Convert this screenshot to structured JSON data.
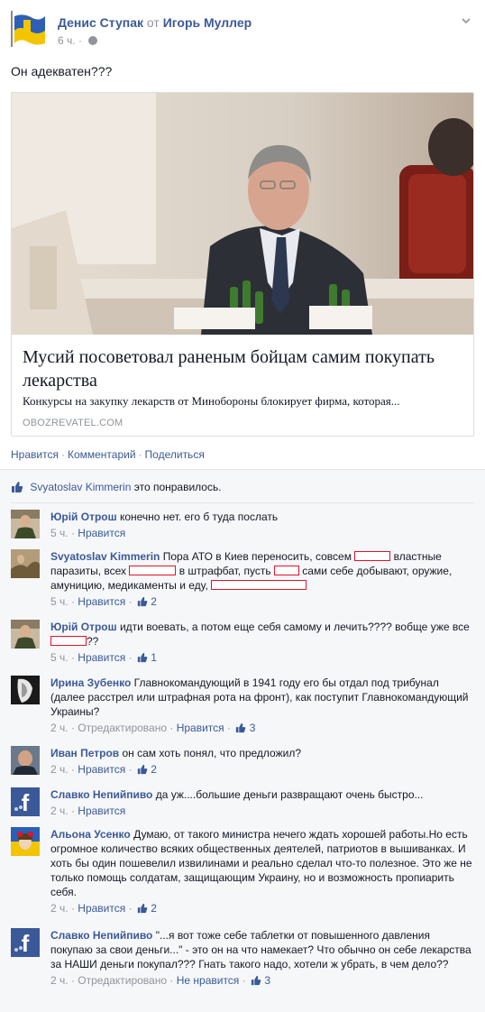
{
  "post": {
    "author": "Денис Ступак",
    "to_word": "от",
    "target": "Игорь Муллер",
    "time": "6 ч.",
    "text": "Он адекватен???",
    "link": {
      "title": "Мусий посоветовал раненым бойцам самим покупать лекарства",
      "description": "Конкурсы на закупку лекарств от Минобороны блокирует фирма, которая...",
      "domain": "OBOZREVATEL.COM"
    },
    "actions": {
      "like": "Нравится",
      "comment": "Комментарий",
      "share": "Поделиться",
      "separator": "·"
    }
  },
  "likes": {
    "user": "Svyatoslav Kimmerin",
    "suffix": "это понравилось."
  },
  "comments": [
    {
      "author": "Юрій Отрош",
      "text": "конечно нет. его б туда послать",
      "time": "5 ч.",
      "like": "Нравится",
      "count": ""
    },
    {
      "author": "Svyatoslav Kimmerin",
      "parts": [
        "Пора АТО в Киев переносить, совсем",
        "властные паразиты, всех",
        "в штрафбат, пусть",
        "сами себе добывают, оружие, амуницию, медикаменты и еду,"
      ],
      "time": "5 ч.",
      "like": "Нравится",
      "count": "2"
    },
    {
      "author": "Юрій Отрош",
      "parts": [
        "идти воевать, а потом еще себя самому и лечить???? вобще уже все",
        "??"
      ],
      "time": "5 ч.",
      "like": "Нравится",
      "count": "1"
    },
    {
      "author": "Ирина Зубенко",
      "text": "Главнокомандующий в 1941 году его бы отдал под трибунал (далее расстрел или штрафная рота на фронт), как поступит Главнокомандующий Украины?",
      "time": "2 ч.",
      "edited": "Отредактировано",
      "like": "Нравится",
      "count": "3"
    },
    {
      "author": "Иван Петров",
      "text": "он сам хоть понял, что предложил?",
      "time": "2 ч.",
      "like": "Нравится",
      "count": "2"
    },
    {
      "author": "Славко Непийпиво",
      "text": "да уж....большие деньги развращают очень быстро...",
      "time": "2 ч.",
      "like": "Нравится",
      "count": ""
    },
    {
      "author": "Альона Усенко",
      "text": "Думаю, от такого министра нечего ждать хорошей работы.Но есть огромное количество всяких общественных деятелей, патриотов в вышиванках. И хоть бы один пошевелил извилинами и реально сделал что-то полезное. Это же не только помощь солдатам, защищающим Украину, но и возможность пропиарить себя.",
      "time": "2 ч.",
      "like": "Нравится",
      "count": "2"
    },
    {
      "author": "Славко Непийпиво",
      "text": "\"...я вот тоже себе таблетки от повышенного давления покупаю за свои деньги...\" - это он на что намекает? Что обычно он себе лекарства за НАШИ деньги покупал??? Гнать такого надо, хотели ж убрать, в чем дело??",
      "time": "2 ч.",
      "edited": "Отредактировано",
      "like": "Не нравится",
      "count": "3"
    }
  ],
  "colors": {
    "link": "#3b5998",
    "meta": "#90949c",
    "redact": "#e0142a",
    "ufi_bg": "#f6f7f9"
  }
}
